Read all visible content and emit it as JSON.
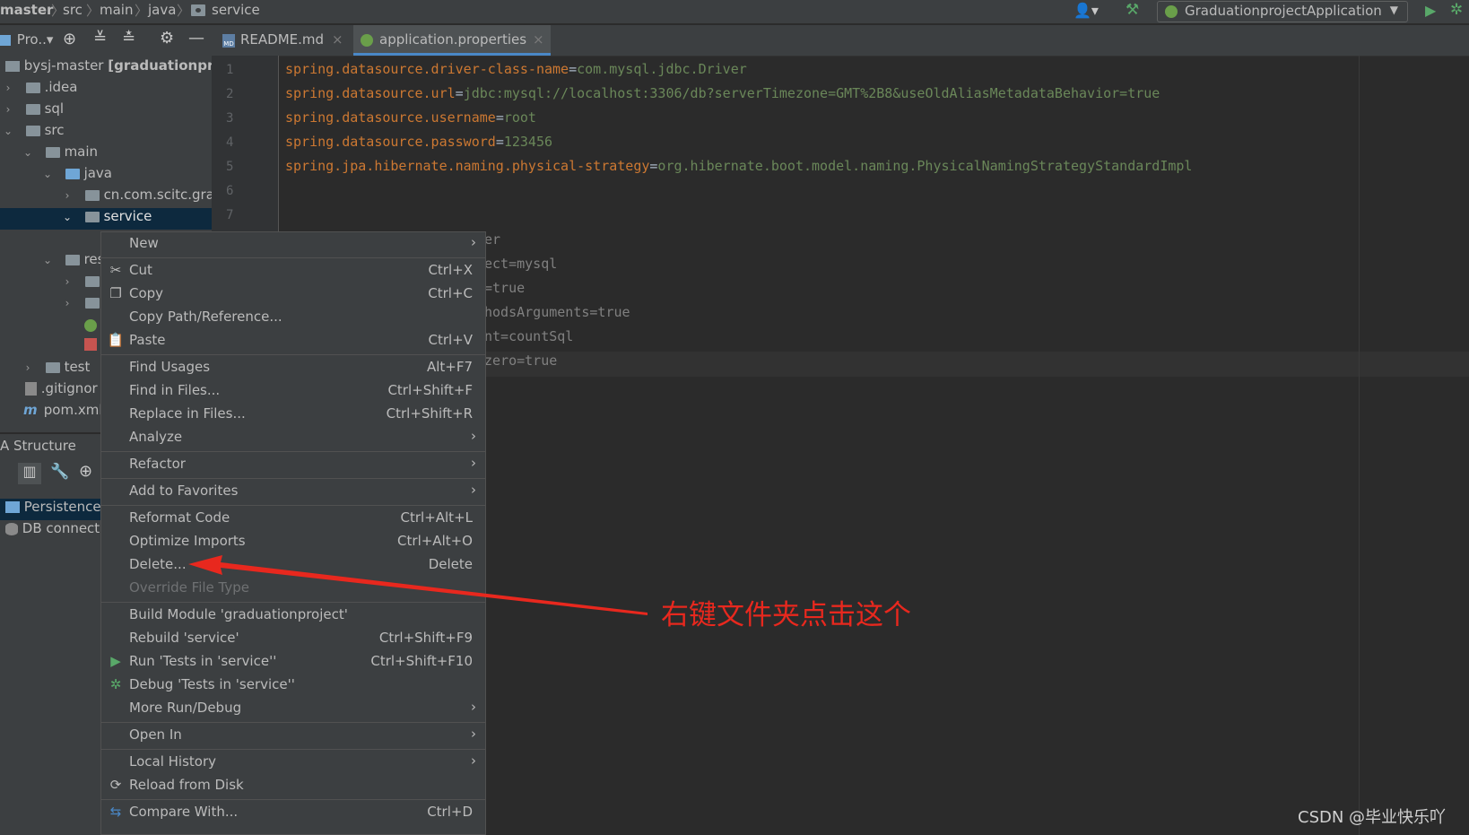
{
  "breadcrumb": {
    "items": [
      "master",
      "src",
      "main",
      "java",
      "service"
    ]
  },
  "run_config": {
    "label": "GraduationprojectApplication"
  },
  "toolbar": {
    "project_label": "Pro..▾"
  },
  "tabs": [
    {
      "label": "README.md",
      "active": false
    },
    {
      "label": "application.properties",
      "active": true
    }
  ],
  "project_tree": {
    "root_label": "bysj-master",
    "root_suffix": "[graduationproj",
    "items": [
      {
        "label": ".idea"
      },
      {
        "label": "sql"
      },
      {
        "label": "src"
      },
      {
        "label": "main"
      },
      {
        "label": "java"
      },
      {
        "label": "cn.com.scitc.gra"
      },
      {
        "label": "service"
      },
      {
        "label": "res"
      },
      {
        "label": "test"
      },
      {
        "label": ".gitignor"
      },
      {
        "label": "pom.xml"
      }
    ]
  },
  "structure": {
    "title": "A Structure",
    "items": [
      {
        "label": "Persistence"
      },
      {
        "label": "DB connecti"
      }
    ]
  },
  "editor": {
    "line_numbers": [
      "1",
      "2",
      "3",
      "4",
      "5",
      "6",
      "7"
    ],
    "lines": [
      {
        "key": "spring.datasource.driver-class-name",
        "value": "com.mysql.jdbc.Driver"
      },
      {
        "key": "spring.datasource.url",
        "value": "jdbc:mysql://localhost:3306/db?serverTimezone=GMT%2B8&useOldAliasMetadataBehavior=true"
      },
      {
        "key": "spring.datasource.username",
        "value": "root"
      },
      {
        "key": "spring.datasource.password",
        "value": "123456"
      },
      {
        "key": "spring.jpa.hibernate.naming.physical-strategy",
        "value": "org.hibernate.boot.model.naming.PhysicalNamingStrategyStandardImpl"
      }
    ],
    "partial_lines": [
      "er",
      "ect=mysql",
      "=true",
      "hodsArguments=true",
      "nt=countSql",
      "zero=true"
    ]
  },
  "context_menu": {
    "items": [
      {
        "label": "New",
        "shortcut": "",
        "submenu": true
      },
      {
        "label": "Cut",
        "shortcut": "Ctrl+X"
      },
      {
        "label": "Copy",
        "shortcut": "Ctrl+C"
      },
      {
        "label": "Copy Path/Reference...",
        "shortcut": ""
      },
      {
        "label": "Paste",
        "shortcut": "Ctrl+V"
      },
      {
        "label": "Find Usages",
        "shortcut": "Alt+F7"
      },
      {
        "label": "Find in Files...",
        "shortcut": "Ctrl+Shift+F"
      },
      {
        "label": "Replace in Files...",
        "shortcut": "Ctrl+Shift+R"
      },
      {
        "label": "Analyze",
        "shortcut": "",
        "submenu": true
      },
      {
        "label": "Refactor",
        "shortcut": "",
        "submenu": true
      },
      {
        "label": "Add to Favorites",
        "shortcut": "",
        "submenu": true
      },
      {
        "label": "Reformat Code",
        "shortcut": "Ctrl+Alt+L"
      },
      {
        "label": "Optimize Imports",
        "shortcut": "Ctrl+Alt+O"
      },
      {
        "label": "Delete...",
        "shortcut": "Delete"
      },
      {
        "label": "Override File Type",
        "shortcut": "",
        "disabled": true
      },
      {
        "label": "Build Module 'graduationproject'",
        "shortcut": ""
      },
      {
        "label": "Rebuild 'service'",
        "shortcut": "Ctrl+Shift+F9"
      },
      {
        "label": "Run 'Tests in 'service''",
        "shortcut": "Ctrl+Shift+F10"
      },
      {
        "label": "Debug 'Tests in 'service''",
        "shortcut": ""
      },
      {
        "label": "More Run/Debug",
        "shortcut": "",
        "submenu": true
      },
      {
        "label": "Open In",
        "shortcut": "",
        "submenu": true
      },
      {
        "label": "Local History",
        "shortcut": "",
        "submenu": true
      },
      {
        "label": "Reload from Disk",
        "shortcut": ""
      },
      {
        "label": "Compare With...",
        "shortcut": "Ctrl+D"
      }
    ]
  },
  "annotation": {
    "text": "右键文件夹点击这个",
    "color": "#e8281e"
  },
  "watermark": "CSDN @毕业快乐吖",
  "colors": {
    "key": "#cc7832",
    "value": "#6a8759",
    "selection": "#0d293e",
    "accent": "#4a88c7"
  }
}
